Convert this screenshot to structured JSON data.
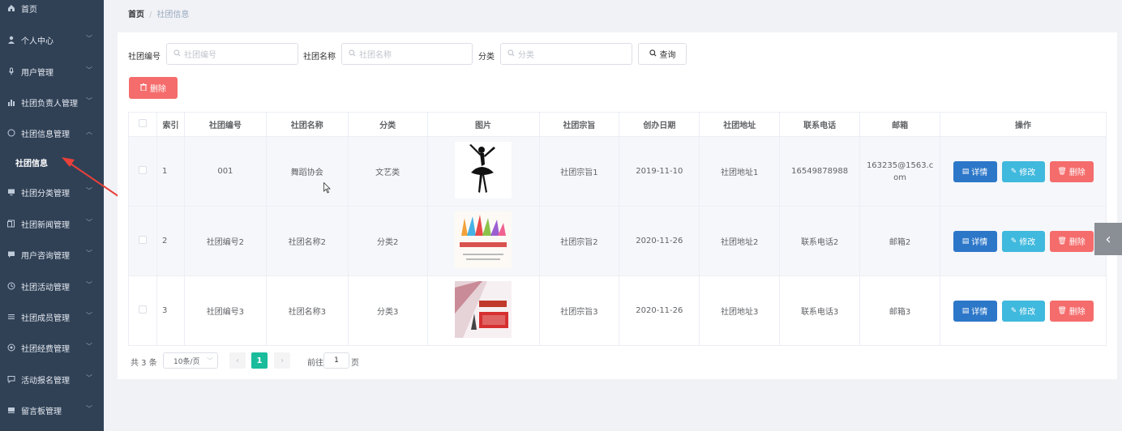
{
  "sidebar": {
    "items": [
      {
        "label": "首页",
        "icon": "home-icon",
        "chevron": false
      },
      {
        "label": "个人中心",
        "icon": "user-icon",
        "chevron": true
      },
      {
        "label": "用户管理",
        "icon": "mic-icon",
        "chevron": true
      },
      {
        "label": "社团负责人管理",
        "icon": "bar-chart-icon",
        "chevron": true
      },
      {
        "label": "社团信息管理",
        "icon": "circle-icon",
        "chevron": true,
        "expanded": true
      },
      {
        "label": "社团信息",
        "icon": "",
        "chevron": false,
        "sub": true
      },
      {
        "label": "社团分类管理",
        "icon": "monitor-icon",
        "chevron": true
      },
      {
        "label": "社团新闻管理",
        "icon": "document-icon",
        "chevron": true
      },
      {
        "label": "用户咨询管理",
        "icon": "chat-icon",
        "chevron": true
      },
      {
        "label": "社团活动管理",
        "icon": "clock-icon",
        "chevron": true
      },
      {
        "label": "社团成员管理",
        "icon": "list-icon",
        "chevron": true
      },
      {
        "label": "社团经费管理",
        "icon": "settings-icon",
        "chevron": true
      },
      {
        "label": "活动报名管理",
        "icon": "message-icon",
        "chevron": true
      },
      {
        "label": "留言板管理",
        "icon": "board-icon",
        "chevron": true
      }
    ]
  },
  "breadcrumb": {
    "root": "首页",
    "sep": "/",
    "current": "社团信息"
  },
  "search": {
    "code_label": "社团编号",
    "code_placeholder": "社团编号",
    "name_label": "社团名称",
    "name_placeholder": "社团名称",
    "category_label": "分类",
    "category_placeholder": "分类",
    "query_label": "查询"
  },
  "toolbar": {
    "delete_label": "删除"
  },
  "table": {
    "headers": [
      "索引",
      "社团编号",
      "社团名称",
      "分类",
      "图片",
      "社团宗旨",
      "创办日期",
      "社团地址",
      "联系电话",
      "邮箱",
      "操作"
    ],
    "rows": [
      {
        "index": "1",
        "code": "001",
        "name": "舞蹈协会",
        "category": "文艺类",
        "image": "dancer-silhouette",
        "purpose": "社团宗旨1",
        "date": "2019-11-10",
        "address": "社团地址1",
        "phone": "16549878988",
        "email": "163235@1563.com"
      },
      {
        "index": "2",
        "code": "社团编号2",
        "name": "社团名称2",
        "category": "分类2",
        "image": "raised-hands-poster",
        "purpose": "社团宗旨2",
        "date": "2020-11-26",
        "address": "社团地址2",
        "phone": "联系电话2",
        "email": "邮箱2"
      },
      {
        "index": "3",
        "code": "社团编号3",
        "name": "社团名称3",
        "category": "分类3",
        "image": "recruitment-poster",
        "purpose": "社团宗旨3",
        "date": "2020-11-26",
        "address": "社团地址3",
        "phone": "联系电话3",
        "email": "邮箱3"
      }
    ],
    "actions": {
      "detail": "详情",
      "edit": "修改",
      "delete": "删除"
    }
  },
  "pagination": {
    "total": "共 3 条",
    "page_size": "10条/页",
    "current": "1",
    "goto_prefix": "前往",
    "goto_value": "1",
    "goto_suffix": "页"
  },
  "colors": {
    "sidebar": "#304156",
    "primary": "#2d77c9",
    "info": "#3fb9dd",
    "danger": "#f56c6c",
    "active_page": "#1abc9c"
  }
}
